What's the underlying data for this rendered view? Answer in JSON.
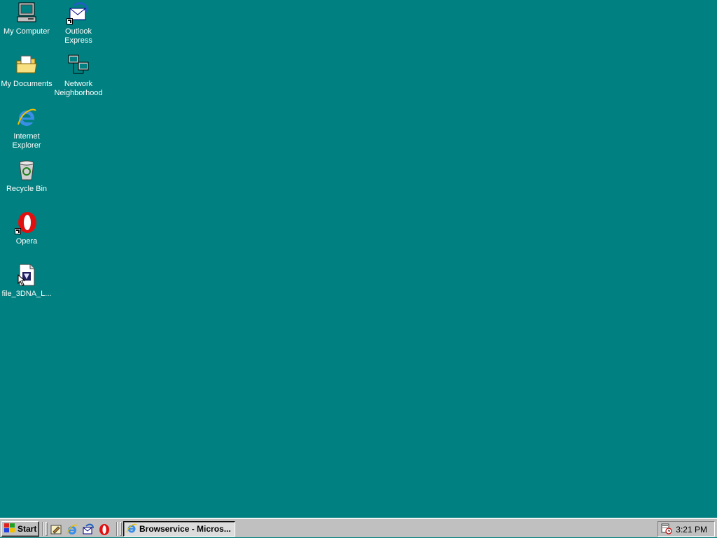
{
  "desktop": {
    "background_color": "#008080",
    "icons": [
      {
        "label": "My Computer",
        "icon": "my-computer-icon"
      },
      {
        "label": "Outlook Express",
        "icon": "outlook-express-icon"
      },
      {
        "label": "My Documents",
        "icon": "my-documents-icon"
      },
      {
        "label": "Network Neighborhood",
        "icon": "network-neighborhood-icon"
      },
      {
        "label": "Internet Explorer",
        "icon": "internet-explorer-icon"
      },
      {
        "label": "Recycle Bin",
        "icon": "recycle-bin-icon"
      },
      {
        "label": "Opera",
        "icon": "opera-icon"
      },
      {
        "label": "file_3DNA_L...",
        "icon": "file-document-icon"
      }
    ]
  },
  "taskbar": {
    "start_label": "Start",
    "quick_launch": [
      "show-desktop-icon",
      "internet-explorer-icon",
      "outlook-express-icon",
      "opera-icon"
    ],
    "task_button_label": "Browservice - Micros...",
    "clock": "3:21 PM",
    "tray_icon": "task-scheduler-icon"
  }
}
